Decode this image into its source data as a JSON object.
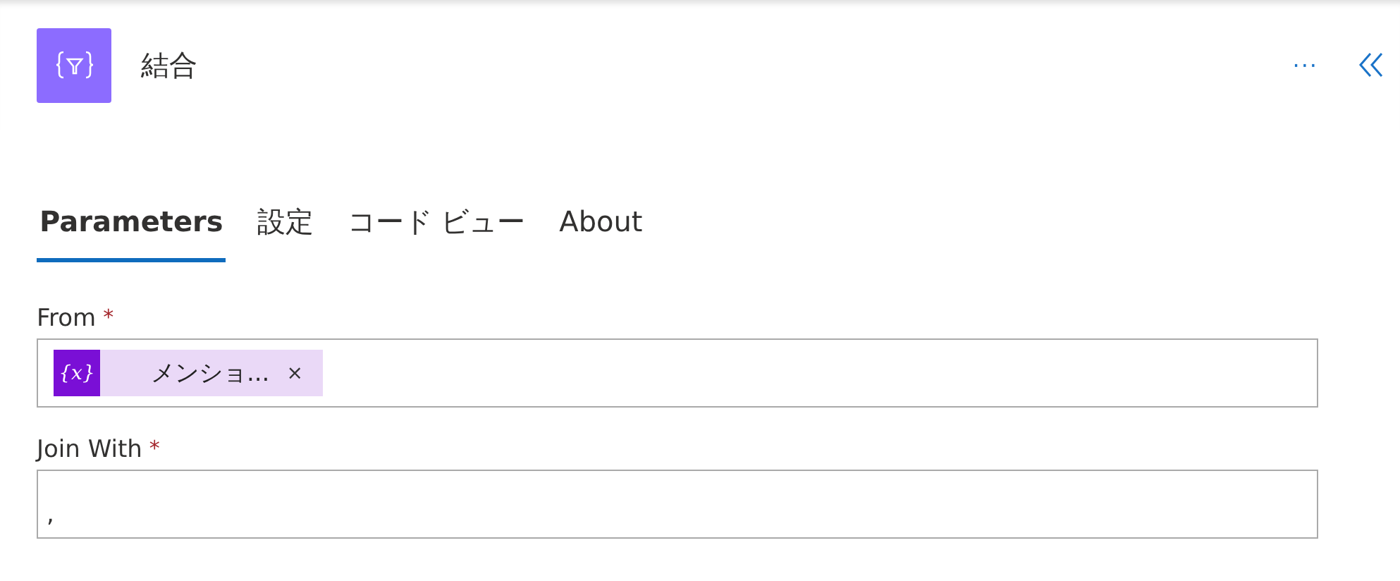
{
  "header": {
    "title": "結合",
    "more": "···"
  },
  "tabs": [
    {
      "label": "Parameters",
      "selected": true
    },
    {
      "label": "設定",
      "selected": false
    },
    {
      "label": "コード ビュー",
      "selected": false
    },
    {
      "label": "About",
      "selected": false
    }
  ],
  "fields": [
    {
      "label": "From",
      "required": true,
      "kind": "token",
      "token": {
        "icon": "{x}",
        "text": "メンショ...",
        "remove": "×"
      }
    },
    {
      "label": "Join With",
      "required": true,
      "kind": "text",
      "value": ","
    }
  ],
  "required_mark": "*"
}
